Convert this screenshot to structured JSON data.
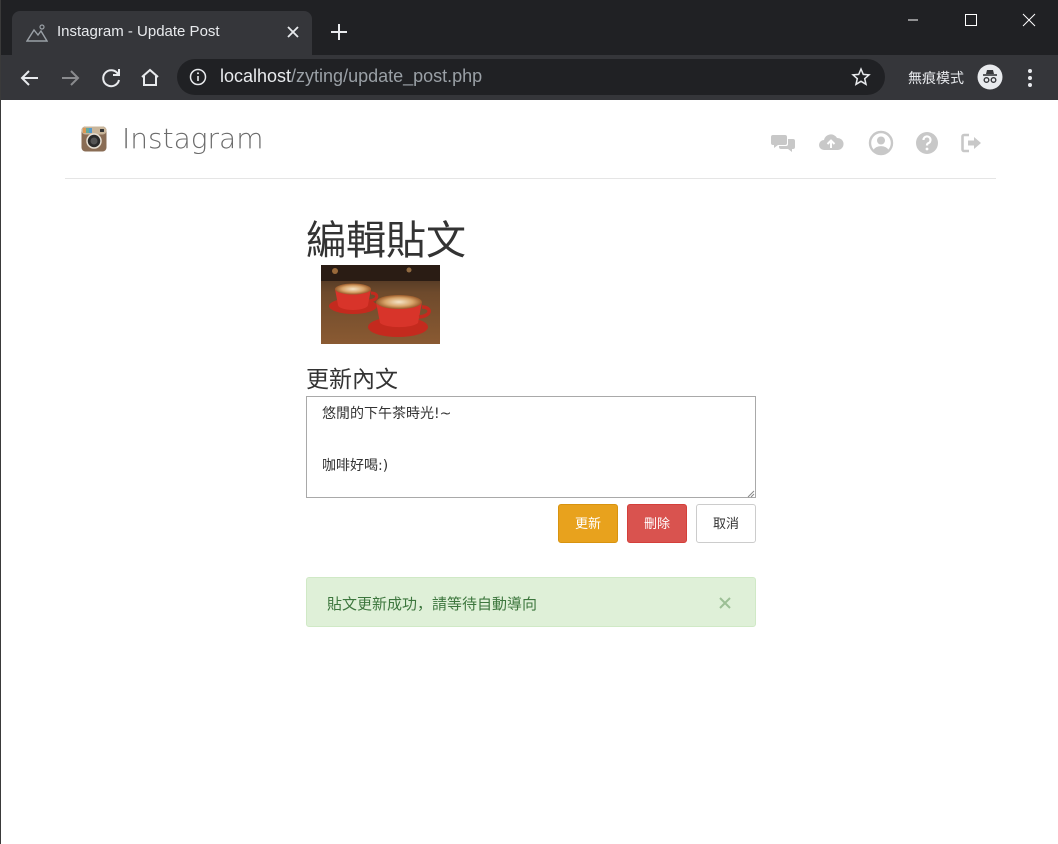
{
  "browser": {
    "tab_title": "Instagram - Update Post",
    "url_host": "localhost",
    "url_path": "/zyting/update_post.php",
    "incognito_label": "無痕模式"
  },
  "navbar": {
    "brand": "Instagram",
    "icons": [
      "comments-icon",
      "cloud-upload-icon",
      "user-circle-icon",
      "question-circle-icon",
      "sign-out-icon"
    ]
  },
  "main": {
    "title": "編輯貼文",
    "image_alt": "兩杯咖啡",
    "content_label": "更新內文",
    "content_value": "悠閒的下午茶時光!~\n\n咖啡好喝:)",
    "buttons": {
      "update": "更新",
      "delete": "刪除",
      "cancel": "取消"
    },
    "alert": "貼文更新成功，請等待自動導向"
  },
  "colors": {
    "update": "#e8a21d",
    "delete": "#d9534f",
    "alert_bg": "#dff0d8",
    "alert_text": "#3c763d"
  }
}
